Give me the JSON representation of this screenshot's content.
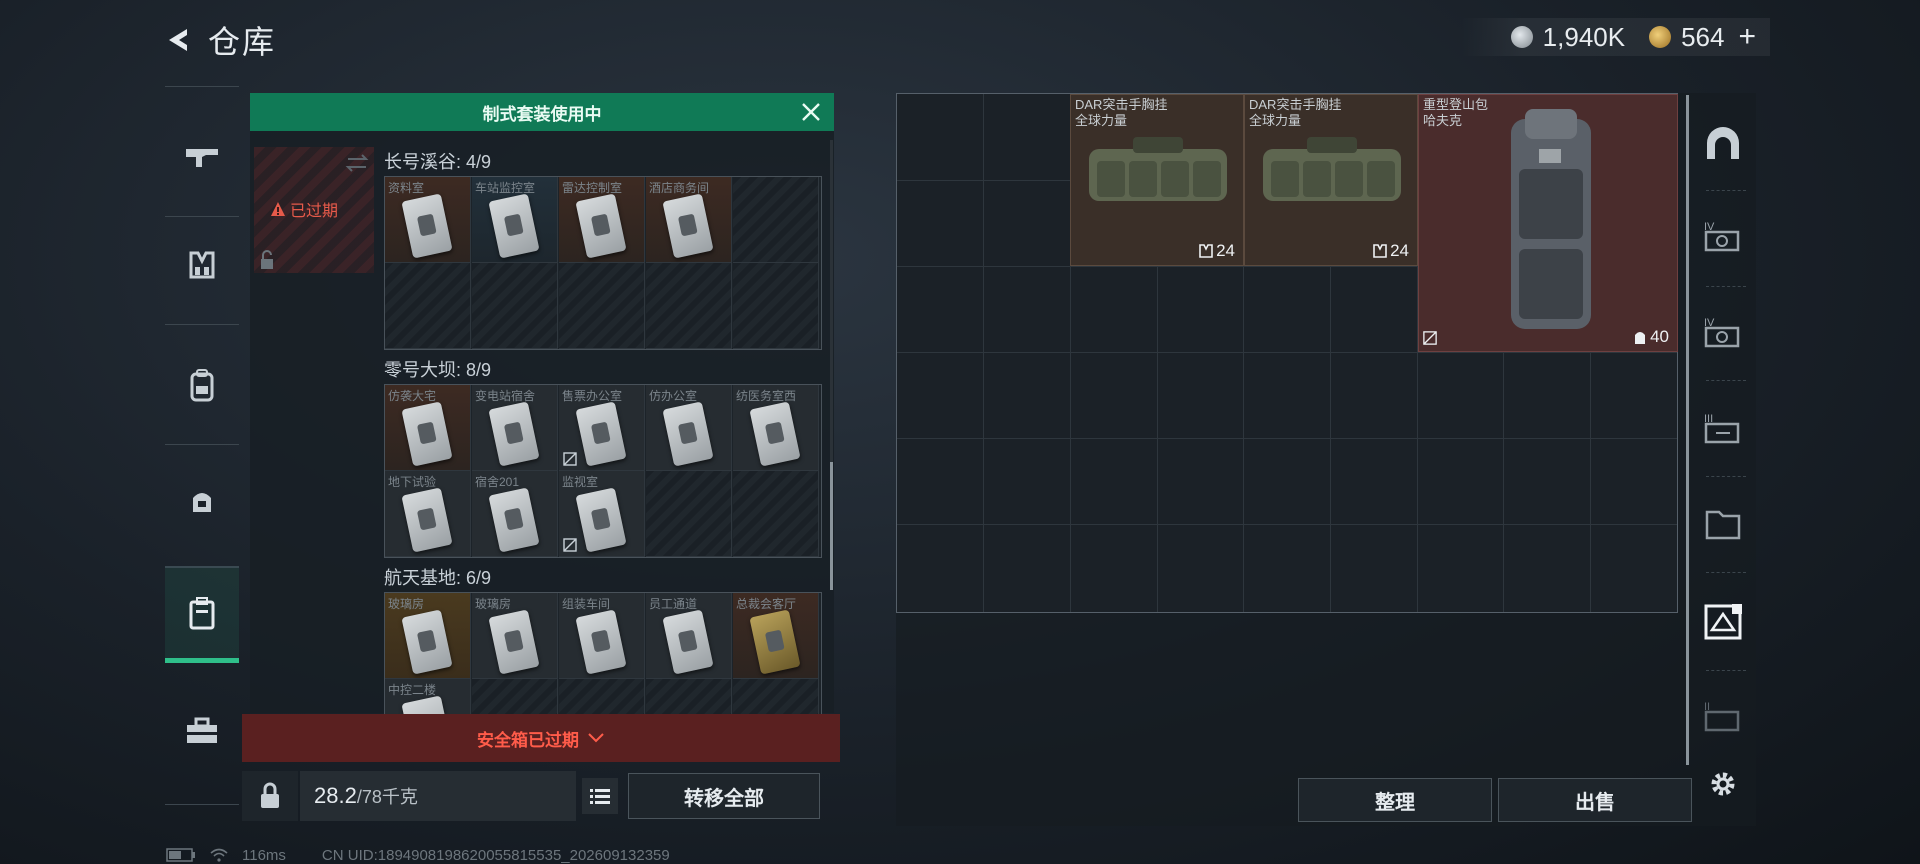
{
  "header": {
    "title": "仓库",
    "back_icon": "back-arrow-icon"
  },
  "currency": [
    {
      "name": "silver-coin",
      "value": "1,940K",
      "color": "#b9c1c7"
    },
    {
      "name": "gold-triangle",
      "value": "564",
      "color": "#d6a84a"
    }
  ],
  "plus_label": "+",
  "left_rail": {
    "items": [
      {
        "icon": "gun-icon"
      },
      {
        "icon": "vest-icon"
      },
      {
        "icon": "backpack-icon"
      },
      {
        "icon": "pouch-icon"
      },
      {
        "icon": "safe-case-icon",
        "active": true
      },
      {
        "icon": "toolbox-icon"
      }
    ]
  },
  "kit": {
    "title": "制式套装使用中",
    "close_icon": "close-icon"
  },
  "case": {
    "status": "已过期",
    "status_color": "#e65a4a"
  },
  "sections": [
    {
      "title": "长号溪谷: 4/9",
      "cells": [
        {
          "label": "资料室",
          "tint": "orange"
        },
        {
          "label": "车站监控室",
          "tint": "blue"
        },
        {
          "label": "雷达控制室",
          "tint": "orange"
        },
        {
          "label": "酒店商务间",
          "tint": "orange"
        },
        {
          "label": ""
        },
        {
          "label": ""
        },
        {
          "label": ""
        },
        {
          "label": ""
        },
        {
          "label": ""
        },
        {
          "label": ""
        }
      ]
    },
    {
      "title": "零号大坝: 8/9",
      "cells": [
        {
          "label": "仿袭大宅",
          "tint": "orange"
        },
        {
          "label": "变电站宿舍"
        },
        {
          "label": "售票办公室",
          "nodrop": true
        },
        {
          "label": "仿办公室"
        },
        {
          "label": "纺医务室西"
        },
        {
          "label": "地下试验"
        },
        {
          "label": "宿舍201"
        },
        {
          "label": "监视室",
          "nodrop": true
        },
        {
          "label": ""
        },
        {
          "label": ""
        }
      ]
    },
    {
      "title": "航天基地: 6/9",
      "cells": [
        {
          "label": "玻璃房",
          "tint": "gold"
        },
        {
          "label": "玻璃房"
        },
        {
          "label": "组装车间"
        },
        {
          "label": "员工通道"
        },
        {
          "label": "总裁会客厅",
          "tint": "orange",
          "gold_card": true
        },
        {
          "label": "中控二楼"
        },
        {
          "label": ""
        },
        {
          "label": ""
        },
        {
          "label": ""
        },
        {
          "label": ""
        }
      ]
    }
  ],
  "expired_bar": {
    "text": "安全箱已过期",
    "icon": "chevron-down-icon"
  },
  "capacity": {
    "current": "28.2",
    "max": "/78千克",
    "lock_icon": "lock-icon",
    "list_icon": "list-icon"
  },
  "transfer_all": "转移全部",
  "stash_items": [
    {
      "name_line1": "DAR突击手胸挂",
      "name_line2": "全球力量",
      "count": "24",
      "count_icon": "vest-icon"
    },
    {
      "name_line1": "DAR突击手胸挂",
      "name_line2": "全球力量",
      "count": "24",
      "count_icon": "vest-icon"
    },
    {
      "name_line1": "重型登山包",
      "name_line2": "哈夫克",
      "count": "40",
      "count_icon": "backpack-icon"
    }
  ],
  "actions": {
    "tidy": "整理",
    "sell": "出售"
  },
  "right_tabs": [
    {
      "icon": "helmet-icon"
    },
    {
      "icon": "keycard-iv-icon"
    },
    {
      "icon": "keycard-iv-2-icon"
    },
    {
      "icon": "keycard-ii-icon"
    },
    {
      "icon": "folder-icon"
    },
    {
      "icon": "stash-grid-icon",
      "active": true
    },
    {
      "icon": "keycard-gear-icon"
    },
    {
      "icon": "settings-gear-icon"
    }
  ],
  "status_bar": {
    "ping": "116ms",
    "uid": "CN UID:1894908198620055815535_202609132359"
  }
}
